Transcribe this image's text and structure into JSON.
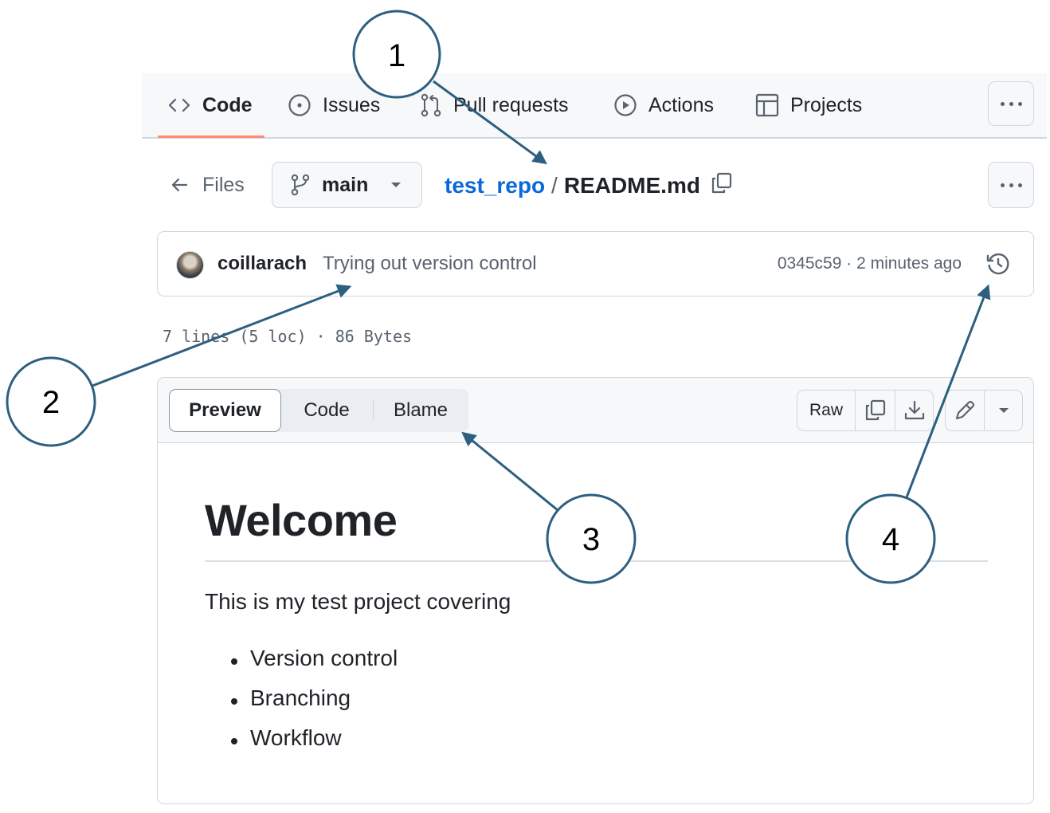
{
  "repo_nav": {
    "tabs": [
      {
        "label": "Code",
        "icon": "code-icon",
        "active": true
      },
      {
        "label": "Issues",
        "icon": "issue-opened-icon",
        "active": false
      },
      {
        "label": "Pull requests",
        "icon": "git-pull-request-icon",
        "active": false
      },
      {
        "label": "Actions",
        "icon": "play-icon",
        "active": false
      },
      {
        "label": "Projects",
        "icon": "table-icon",
        "active": false
      }
    ],
    "more_icon": "kebab-horizontal-icon"
  },
  "file_header": {
    "back_label": "Files",
    "back_icon": "arrow-left-icon",
    "branch": "main",
    "branch_icon": "git-branch-icon",
    "repo_name": "test_repo",
    "separator": "/",
    "file_name": "README.md",
    "copy_icon": "copy-icon",
    "more_icon": "kebab-horizontal-icon"
  },
  "commit": {
    "author": "coillarach",
    "message": "Trying out version control",
    "sha": "0345c59",
    "meta_separator": "·",
    "time": "2 minutes ago",
    "history_icon": "history-icon"
  },
  "file_info": "7 lines (5 loc) · 86 Bytes",
  "viewer": {
    "tabs": [
      {
        "label": "Preview",
        "active": true
      },
      {
        "label": "Code",
        "active": false
      },
      {
        "label": "Blame",
        "active": false
      }
    ],
    "actions": {
      "raw_label": "Raw",
      "copy_icon": "copy-icon",
      "download_icon": "download-icon",
      "edit_icon": "pencil-icon",
      "dropdown_icon": "triangle-down-icon"
    }
  },
  "readme": {
    "heading": "Welcome",
    "paragraph": "This is my test project covering",
    "list": [
      "Version control",
      "Branching",
      "Workflow"
    ]
  },
  "annotations": {
    "color": "#2d5f80",
    "callouts": [
      "1",
      "2",
      "3",
      "4"
    ]
  },
  "colors": {
    "link": "#0969da",
    "active_tab_underline": "#fd8c73",
    "muted_text": "#59636e",
    "text": "#1f2328",
    "border": "#d0d7de"
  }
}
